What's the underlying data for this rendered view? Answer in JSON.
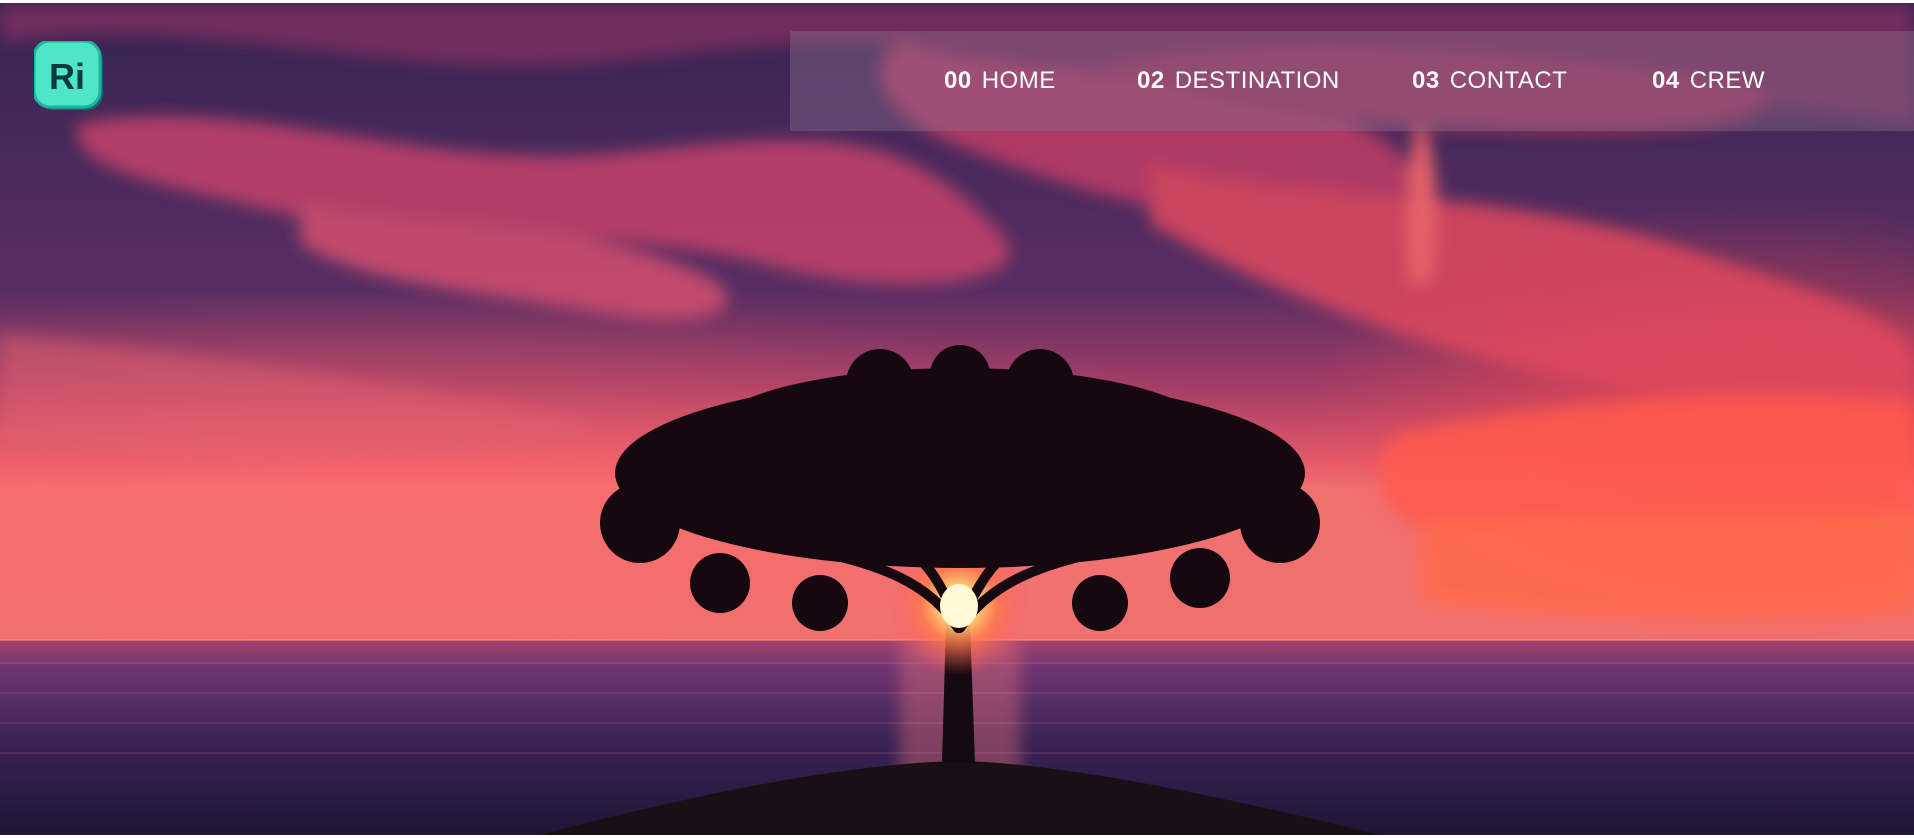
{
  "brand": {
    "logo_text": "Ri",
    "logo_colors": {
      "fill": "#4ee6c4",
      "stroke": "#1fb3a5",
      "shadow": "#0d6e6a"
    }
  },
  "nav": {
    "items": [
      {
        "num": "00",
        "label": "HOME"
      },
      {
        "num": "02",
        "label": "DESTINATION"
      },
      {
        "num": "03",
        "label": "CONTACT"
      },
      {
        "num": "04",
        "label": "CREW"
      }
    ]
  },
  "hero": {
    "subject": "tree-silhouette-sunset-sea",
    "colors": {
      "sky_top": "#3a2458",
      "sky_mid": "#8c2f62",
      "glow": "#ff5a5f",
      "sea": "#2a1840"
    }
  }
}
